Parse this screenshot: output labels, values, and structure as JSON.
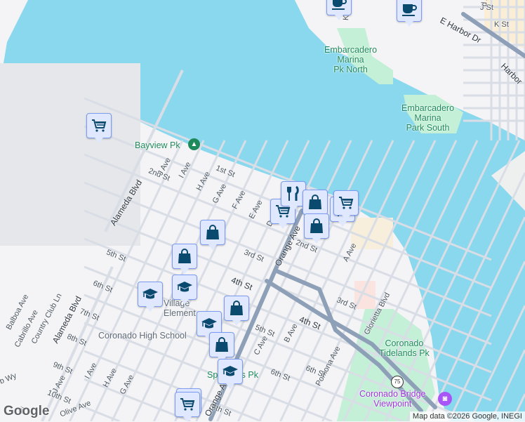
{
  "colors": {
    "water": "#8ad8ee",
    "land": "#f4f3f5",
    "park": "#c3f0d6",
    "road": "#d9dde6",
    "highway": "#8ea0b8",
    "pin_bg": "#dfe8ff",
    "pin_icon": "#0b4a6f"
  },
  "parks": {
    "marina_north": "Embarcadero\nMarina\nPk North",
    "marina_south": "Embarcadero\nMarina\nPark South",
    "bayview": "Bayview Pk",
    "tidelands": "Coronado\nTidelands Pk",
    "spreckels": "Spreckels Pk"
  },
  "schools": {
    "coronado_high": "Coronado High School",
    "village_elem": "Village\nElement"
  },
  "poi": {
    "bridge_viewpoint": "Coronado Bridge\nViewpoint"
  },
  "streets": [
    "1st St",
    "2nd St",
    "3rd St",
    "4th St",
    "5th St",
    "6th St",
    "7th St",
    "8th St",
    "9th St",
    "10th St",
    "2nd St",
    "3rd St",
    "4th St",
    "5th St",
    "6th St",
    "8th St",
    "J Ave",
    "I Ave",
    "H Ave",
    "G Ave",
    "F Ave",
    "E Ave",
    "D",
    "Orange Ave",
    "Alameda Blvd",
    "Alameda Blvd",
    "Balboa Ave",
    "Cabrillo Ave",
    "Country Club Ln",
    "J Ave",
    "I Ave",
    "H Ave",
    "G Ave",
    "C Ave",
    "B Ave",
    "A Ave",
    "Pomona Ave",
    "Glorietta Blvd",
    "E Harbor Dr",
    "Harbor",
    "J St",
    "K St",
    "Kettner",
    "Olive Ave",
    "b Wy",
    "Orange Ave",
    "6th St",
    "Pi",
    "d Ave"
  ],
  "route_shield": "75",
  "pins": [
    {
      "icon": "cart-icon"
    },
    {
      "icon": "bag-icon"
    },
    {
      "icon": "bag-icon"
    },
    {
      "icon": "graduation-cap-icon"
    },
    {
      "icon": "graduation-cap-icon"
    },
    {
      "icon": "graduation-cap-icon"
    },
    {
      "icon": "bag-icon"
    },
    {
      "icon": "bag-icon"
    },
    {
      "icon": "graduation-cap-icon"
    },
    {
      "icon": "cart-icon"
    },
    {
      "icon": "cart-icon"
    },
    {
      "icon": "fork-knife-icon"
    },
    {
      "icon": "bag-icon"
    },
    {
      "icon": "bag-icon"
    },
    {
      "icon": "fork-knife-icon"
    },
    {
      "icon": "coffee-icon"
    },
    {
      "icon": "coffee-icon"
    },
    {
      "icon": "cart-icon"
    },
    {
      "icon": "cart-icon"
    }
  ],
  "attribution": "Map data ©2026 Google, INEGI",
  "logo": "Google"
}
